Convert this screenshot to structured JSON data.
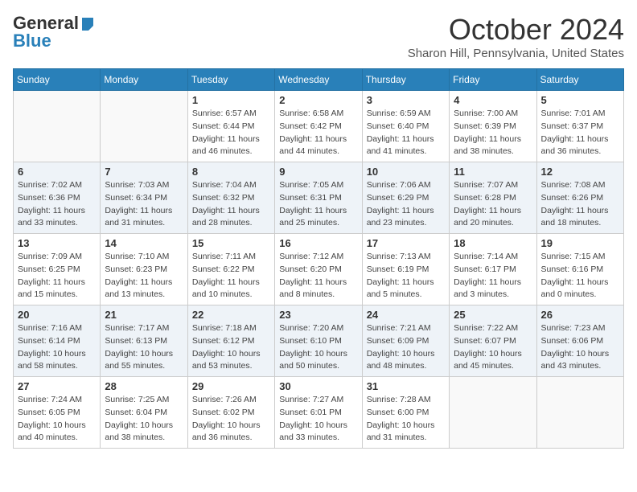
{
  "header": {
    "logo_line1": "General",
    "logo_line2": "Blue",
    "month_title": "October 2024",
    "location": "Sharon Hill, Pennsylvania, United States"
  },
  "weekdays": [
    "Sunday",
    "Monday",
    "Tuesday",
    "Wednesday",
    "Thursday",
    "Friday",
    "Saturday"
  ],
  "weeks": [
    [
      {
        "day": "",
        "sunrise": "",
        "sunset": "",
        "daylight": ""
      },
      {
        "day": "",
        "sunrise": "",
        "sunset": "",
        "daylight": ""
      },
      {
        "day": "1",
        "sunrise": "Sunrise: 6:57 AM",
        "sunset": "Sunset: 6:44 PM",
        "daylight": "Daylight: 11 hours and 46 minutes."
      },
      {
        "day": "2",
        "sunrise": "Sunrise: 6:58 AM",
        "sunset": "Sunset: 6:42 PM",
        "daylight": "Daylight: 11 hours and 44 minutes."
      },
      {
        "day": "3",
        "sunrise": "Sunrise: 6:59 AM",
        "sunset": "Sunset: 6:40 PM",
        "daylight": "Daylight: 11 hours and 41 minutes."
      },
      {
        "day": "4",
        "sunrise": "Sunrise: 7:00 AM",
        "sunset": "Sunset: 6:39 PM",
        "daylight": "Daylight: 11 hours and 38 minutes."
      },
      {
        "day": "5",
        "sunrise": "Sunrise: 7:01 AM",
        "sunset": "Sunset: 6:37 PM",
        "daylight": "Daylight: 11 hours and 36 minutes."
      }
    ],
    [
      {
        "day": "6",
        "sunrise": "Sunrise: 7:02 AM",
        "sunset": "Sunset: 6:36 PM",
        "daylight": "Daylight: 11 hours and 33 minutes."
      },
      {
        "day": "7",
        "sunrise": "Sunrise: 7:03 AM",
        "sunset": "Sunset: 6:34 PM",
        "daylight": "Daylight: 11 hours and 31 minutes."
      },
      {
        "day": "8",
        "sunrise": "Sunrise: 7:04 AM",
        "sunset": "Sunset: 6:32 PM",
        "daylight": "Daylight: 11 hours and 28 minutes."
      },
      {
        "day": "9",
        "sunrise": "Sunrise: 7:05 AM",
        "sunset": "Sunset: 6:31 PM",
        "daylight": "Daylight: 11 hours and 25 minutes."
      },
      {
        "day": "10",
        "sunrise": "Sunrise: 7:06 AM",
        "sunset": "Sunset: 6:29 PM",
        "daylight": "Daylight: 11 hours and 23 minutes."
      },
      {
        "day": "11",
        "sunrise": "Sunrise: 7:07 AM",
        "sunset": "Sunset: 6:28 PM",
        "daylight": "Daylight: 11 hours and 20 minutes."
      },
      {
        "day": "12",
        "sunrise": "Sunrise: 7:08 AM",
        "sunset": "Sunset: 6:26 PM",
        "daylight": "Daylight: 11 hours and 18 minutes."
      }
    ],
    [
      {
        "day": "13",
        "sunrise": "Sunrise: 7:09 AM",
        "sunset": "Sunset: 6:25 PM",
        "daylight": "Daylight: 11 hours and 15 minutes."
      },
      {
        "day": "14",
        "sunrise": "Sunrise: 7:10 AM",
        "sunset": "Sunset: 6:23 PM",
        "daylight": "Daylight: 11 hours and 13 minutes."
      },
      {
        "day": "15",
        "sunrise": "Sunrise: 7:11 AM",
        "sunset": "Sunset: 6:22 PM",
        "daylight": "Daylight: 11 hours and 10 minutes."
      },
      {
        "day": "16",
        "sunrise": "Sunrise: 7:12 AM",
        "sunset": "Sunset: 6:20 PM",
        "daylight": "Daylight: 11 hours and 8 minutes."
      },
      {
        "day": "17",
        "sunrise": "Sunrise: 7:13 AM",
        "sunset": "Sunset: 6:19 PM",
        "daylight": "Daylight: 11 hours and 5 minutes."
      },
      {
        "day": "18",
        "sunrise": "Sunrise: 7:14 AM",
        "sunset": "Sunset: 6:17 PM",
        "daylight": "Daylight: 11 hours and 3 minutes."
      },
      {
        "day": "19",
        "sunrise": "Sunrise: 7:15 AM",
        "sunset": "Sunset: 6:16 PM",
        "daylight": "Daylight: 11 hours and 0 minutes."
      }
    ],
    [
      {
        "day": "20",
        "sunrise": "Sunrise: 7:16 AM",
        "sunset": "Sunset: 6:14 PM",
        "daylight": "Daylight: 10 hours and 58 minutes."
      },
      {
        "day": "21",
        "sunrise": "Sunrise: 7:17 AM",
        "sunset": "Sunset: 6:13 PM",
        "daylight": "Daylight: 10 hours and 55 minutes."
      },
      {
        "day": "22",
        "sunrise": "Sunrise: 7:18 AM",
        "sunset": "Sunset: 6:12 PM",
        "daylight": "Daylight: 10 hours and 53 minutes."
      },
      {
        "day": "23",
        "sunrise": "Sunrise: 7:20 AM",
        "sunset": "Sunset: 6:10 PM",
        "daylight": "Daylight: 10 hours and 50 minutes."
      },
      {
        "day": "24",
        "sunrise": "Sunrise: 7:21 AM",
        "sunset": "Sunset: 6:09 PM",
        "daylight": "Daylight: 10 hours and 48 minutes."
      },
      {
        "day": "25",
        "sunrise": "Sunrise: 7:22 AM",
        "sunset": "Sunset: 6:07 PM",
        "daylight": "Daylight: 10 hours and 45 minutes."
      },
      {
        "day": "26",
        "sunrise": "Sunrise: 7:23 AM",
        "sunset": "Sunset: 6:06 PM",
        "daylight": "Daylight: 10 hours and 43 minutes."
      }
    ],
    [
      {
        "day": "27",
        "sunrise": "Sunrise: 7:24 AM",
        "sunset": "Sunset: 6:05 PM",
        "daylight": "Daylight: 10 hours and 40 minutes."
      },
      {
        "day": "28",
        "sunrise": "Sunrise: 7:25 AM",
        "sunset": "Sunset: 6:04 PM",
        "daylight": "Daylight: 10 hours and 38 minutes."
      },
      {
        "day": "29",
        "sunrise": "Sunrise: 7:26 AM",
        "sunset": "Sunset: 6:02 PM",
        "daylight": "Daylight: 10 hours and 36 minutes."
      },
      {
        "day": "30",
        "sunrise": "Sunrise: 7:27 AM",
        "sunset": "Sunset: 6:01 PM",
        "daylight": "Daylight: 10 hours and 33 minutes."
      },
      {
        "day": "31",
        "sunrise": "Sunrise: 7:28 AM",
        "sunset": "Sunset: 6:00 PM",
        "daylight": "Daylight: 10 hours and 31 minutes."
      },
      {
        "day": "",
        "sunrise": "",
        "sunset": "",
        "daylight": ""
      },
      {
        "day": "",
        "sunrise": "",
        "sunset": "",
        "daylight": ""
      }
    ]
  ]
}
